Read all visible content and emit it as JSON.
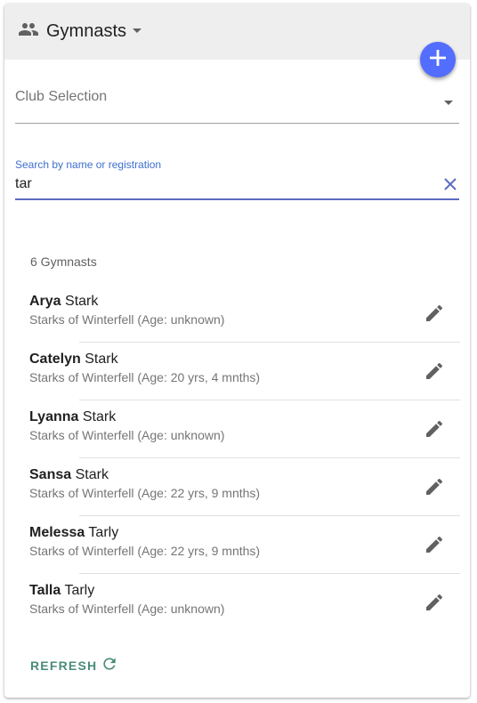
{
  "header": {
    "title": "Gymnasts",
    "icon": "people-icon",
    "caret_icon": "caret-down-icon"
  },
  "fab": {
    "icon": "plus-icon",
    "color": "#536dfe"
  },
  "club_select": {
    "placeholder": "Club Selection",
    "icon": "dropdown-arrow-icon"
  },
  "search": {
    "label": "Search by name or registration",
    "value": "tar",
    "clear_icon": "close-icon",
    "accent": "#5c6bc0"
  },
  "count_text": "6 Gymnasts",
  "gymnasts": [
    {
      "first": "Arya",
      "last": "Stark",
      "detail": "Starks of Winterfell (Age: unknown)"
    },
    {
      "first": "Catelyn",
      "last": "Stark",
      "detail": "Starks of Winterfell (Age: 20 yrs, 4 mnths)"
    },
    {
      "first": "Lyanna",
      "last": "Stark",
      "detail": "Starks of Winterfell (Age: unknown)"
    },
    {
      "first": "Sansa",
      "last": "Stark",
      "detail": "Starks of Winterfell (Age: 22 yrs, 9 mnths)"
    },
    {
      "first": "Melessa",
      "last": "Tarly",
      "detail": "Starks of Winterfell (Age: 22 yrs, 9 mnths)"
    },
    {
      "first": "Talla",
      "last": "Tarly",
      "detail": "Starks of Winterfell (Age: unknown)"
    }
  ],
  "refresh": {
    "label": "REFRESH",
    "icon": "refresh-icon",
    "color": "#4a8c7a"
  }
}
